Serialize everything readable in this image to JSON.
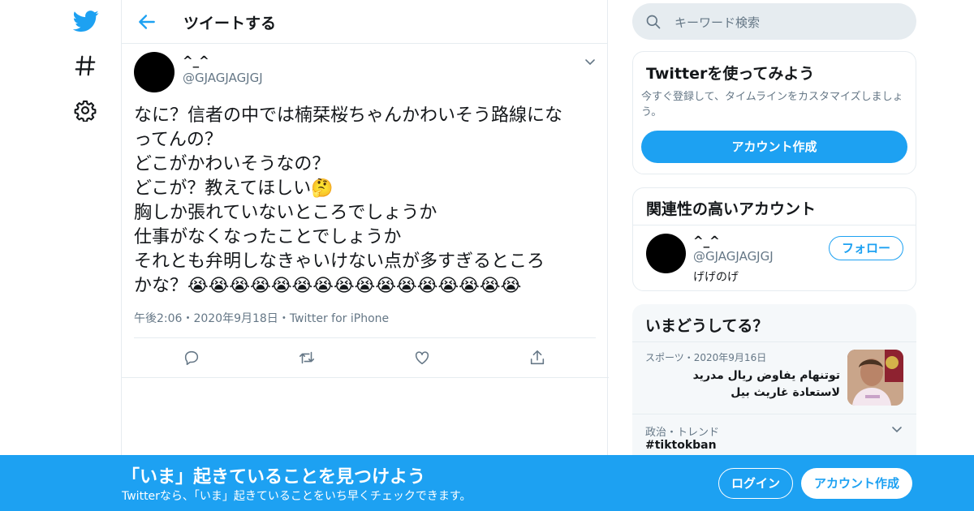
{
  "colors": {
    "accent": "#1da1f2",
    "text": "#14171a",
    "muted": "#657786",
    "border": "#e6ecf0"
  },
  "nav": {
    "icons": [
      "twitter-logo-icon",
      "hashtag-icon",
      "gear-icon"
    ]
  },
  "header": {
    "title": "ツイートする"
  },
  "tweet": {
    "name": "^_^",
    "handle": "@GJAGJAGJGJ",
    "text": "なに？信者の中では楠栞桜ちゃんかわいそう路線にな\nってんの？\nどこがかわいそうなの？\nどこが？教えてほしい🤔\n胸しか張れていないところでしょうか\n仕事がなくなったことでしょうか\nそれとも弁明しなきゃいけない点が多すぎるところ\nかな？😭😭😭😭😭😭😭😭😭😭😭😭😭😭😭😭",
    "time": "午後2:06",
    "date": "2020年9月18日",
    "source": "Twitter for iPhone",
    "meta_sep": "・"
  },
  "right": {
    "search_placeholder": "キーワード検索",
    "signup_card": {
      "title": "Twitterを使ってみよう",
      "desc": "今すぐ登録して、タイムラインをカスタマイズしましょう。",
      "button": "アカウント作成"
    },
    "related": {
      "title": "関連性の高いアカウント",
      "name": "^_^",
      "handle": "@GJAGJAGJGJ",
      "bio": "げげのげ",
      "follow": "フォロー"
    },
    "trends": {
      "title": "いまどうしてる？",
      "items": [
        {
          "meta": "スポーツ・2020年9月16日",
          "text": "توتنهام يفاوض ريال مدريد لاستعادة غاريث بيل"
        },
        {
          "meta": "政治・トレンド",
          "text": "#tiktokban"
        }
      ]
    }
  },
  "banner": {
    "title": "「いま」起きていることを見つけよう",
    "subtitle": "Twitterなら、「いま」起きていることをいち早くチェックできます。",
    "login": "ログイン",
    "signup": "アカウント作成"
  }
}
